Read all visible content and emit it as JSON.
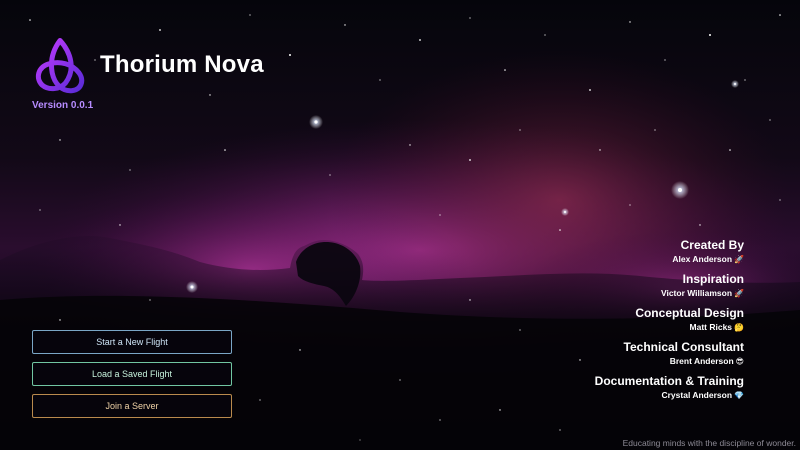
{
  "app": {
    "title": "Thorium Nova",
    "version": "Version 0.0.1",
    "tagline": "Educating minds with the discipline of wonder."
  },
  "menu": {
    "buttons": [
      {
        "label": "Start a New Flight"
      },
      {
        "label": "Load a Saved Flight"
      },
      {
        "label": "Join a Server"
      }
    ]
  },
  "credits": [
    {
      "role": "Created By",
      "name": "Alex Anderson",
      "emoji": "🚀"
    },
    {
      "role": "Inspiration",
      "name": "Victor Williamson",
      "emoji": "🚀"
    },
    {
      "role": "Conceptual Design",
      "name": "Matt Ricks",
      "emoji": "🤔"
    },
    {
      "role": "Technical Consultant",
      "name": "Brent Anderson",
      "emoji": "😎"
    },
    {
      "role": "Documentation & Training",
      "name": "Crystal Anderson",
      "emoji": "💎"
    }
  ],
  "colors": {
    "logo_gradient_start": "#c43bff",
    "logo_gradient_end": "#5a2bd6",
    "version": "#b78cff",
    "btn_new_border": "#7aa6c6",
    "btn_load_border": "#71c6a2",
    "btn_join_border": "#b98a4d"
  }
}
